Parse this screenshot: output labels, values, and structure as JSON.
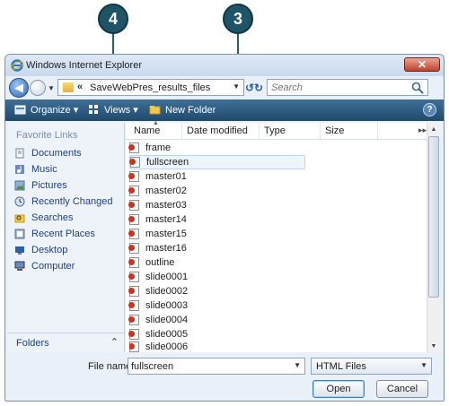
{
  "callouts": {
    "left": "4",
    "right": "3"
  },
  "window": {
    "title": "Windows Internet Explorer",
    "close_label": "✕"
  },
  "address": {
    "path": "SaveWebPres_results_files",
    "chevrons": "«"
  },
  "search": {
    "placeholder": "Search"
  },
  "toolbar": {
    "organize": "Organize ▾",
    "views": "Views ▾",
    "new_folder": "New Folder",
    "help": "?"
  },
  "favorites": {
    "heading": "Favorite Links",
    "items": [
      {
        "label": "Documents",
        "icon": "documents-icon"
      },
      {
        "label": "Music",
        "icon": "music-icon"
      },
      {
        "label": "Pictures",
        "icon": "pictures-icon"
      },
      {
        "label": "Recently Changed",
        "icon": "recently-changed-icon"
      },
      {
        "label": "Searches",
        "icon": "searches-icon"
      },
      {
        "label": "Recent Places",
        "icon": "recent-places-icon"
      },
      {
        "label": "Desktop",
        "icon": "desktop-icon"
      },
      {
        "label": "Computer",
        "icon": "computer-icon"
      }
    ]
  },
  "folders": {
    "label": "Folders",
    "chevron": "⌃"
  },
  "columns": {
    "name": "Name",
    "date": "Date modified",
    "type": "Type",
    "size": "Size",
    "more": "▸▸"
  },
  "files": [
    "frame",
    "fullscreen",
    "master01",
    "master02",
    "master03",
    "master14",
    "master15",
    "master16",
    "outline",
    "slide0001",
    "slide0002",
    "slide0003",
    "slide0004",
    "slide0005",
    "slide0006"
  ],
  "selected_file": "fullscreen",
  "bottom": {
    "filename_label": "File name:",
    "filename_value": "fullscreen",
    "filetype": "HTML Files",
    "open": "Open",
    "cancel": "Cancel"
  },
  "colors": {
    "toolbar": "#1f4a6d",
    "callout": "#1f5466",
    "link": "#1e3f8a"
  }
}
